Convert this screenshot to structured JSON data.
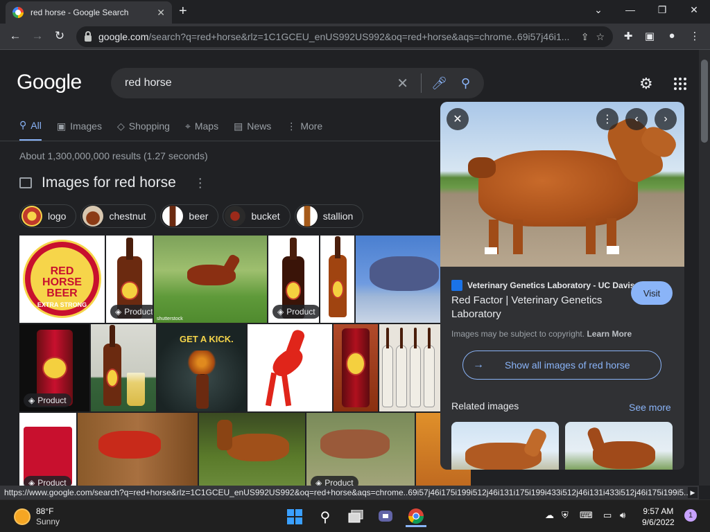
{
  "browser": {
    "tab_title": "red horse - Google Search",
    "url_host": "google.com",
    "url_path": "/search?q=red+horse&rlz=1C1GCEU_enUS992US992&oq=red+horse&aqs=chrome..69i57j46i1..."
  },
  "search": {
    "logo": "Google",
    "query": "red horse"
  },
  "tabs": [
    {
      "label": "All"
    },
    {
      "label": "Images"
    },
    {
      "label": "Shopping"
    },
    {
      "label": "Maps"
    },
    {
      "label": "News"
    },
    {
      "label": "More"
    }
  ],
  "results": {
    "stats": "About 1,300,000,000 results (1.27 seconds)",
    "images_heading": "Images for red horse",
    "chips": [
      {
        "label": "logo"
      },
      {
        "label": "chestnut"
      },
      {
        "label": "beer"
      },
      {
        "label": "bucket"
      },
      {
        "label": "stallion"
      }
    ],
    "product_badge": "Product",
    "logo_text": {
      "line1": "RED",
      "line2": "HORSE",
      "line3": "BEER",
      "line4": "EXTRA STRONG"
    },
    "kick_text": "GET A KICK.",
    "watermark": "shutterstock"
  },
  "panel": {
    "source": "Veterinary Genetics Laboratory - UC Davis",
    "title": "Red Factor | Veterinary Genetics Laboratory",
    "visit": "Visit",
    "copyright": "Images may be subject to copyright.",
    "learn_more": "Learn More",
    "show_all": "Show all images of red horse",
    "related": "Related images",
    "see_more": "See more"
  },
  "status_url": "https://www.google.com/search?q=red+horse&rlz=1C1GCEU_enUS992US992&oq=red+horse&aqs=chrome..69i57j46i175i199i512j46i131i175i199i433i512j46i131i433i512j46i175i199i5...",
  "taskbar": {
    "temp": "88°F",
    "condition": "Sunny",
    "time": "9:57 AM",
    "date": "9/6/2022",
    "notifications": "1"
  }
}
